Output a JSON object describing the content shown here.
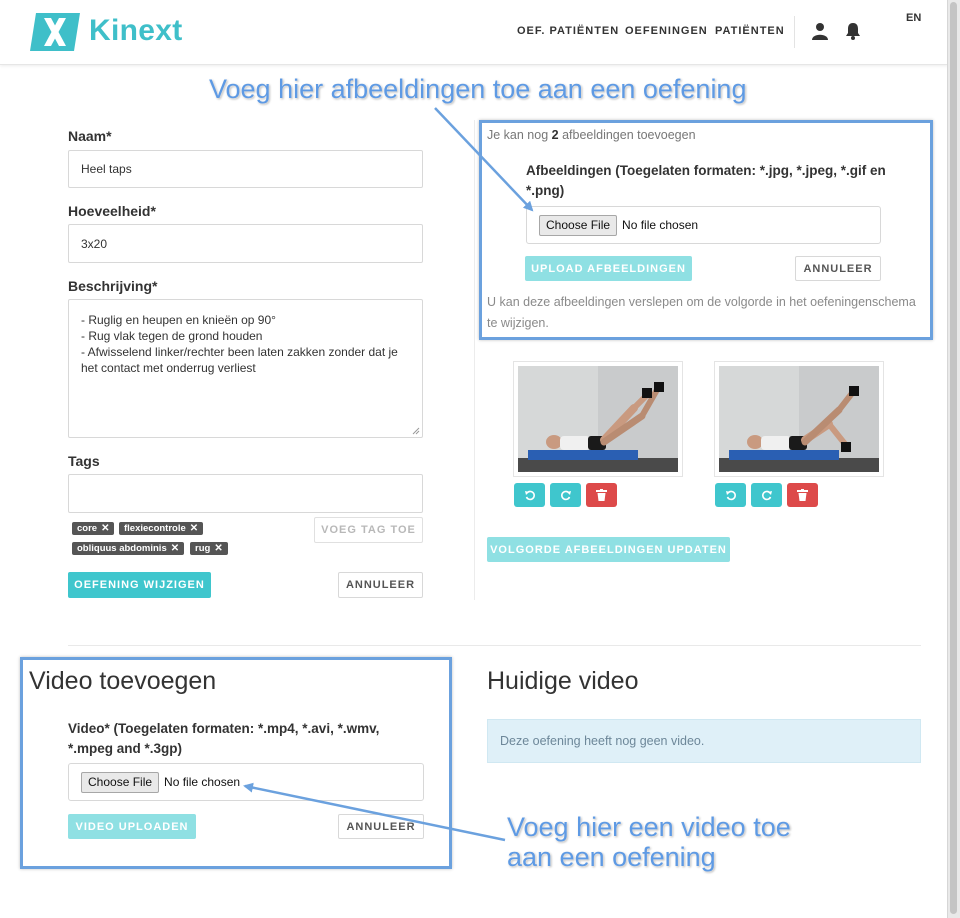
{
  "header": {
    "brand": "Kinext",
    "nav": [
      "OEF. PATIËNTEN",
      "OEFENINGEN",
      "PATIËNTEN"
    ],
    "lang": "EN"
  },
  "form": {
    "name_label": "Naam*",
    "name_value": "Heel taps",
    "quantity_label": "Hoeveelheid*",
    "quantity_value": "3x20",
    "description_label": "Beschrijving*",
    "description_lines": [
      "- Ruglig en heupen en knieën op 90°",
      "- Rug vlak tegen de grond houden",
      "- Afwisselend linker/rechter been laten zakken zonder dat je",
      "het contact met onderrug verliest"
    ],
    "tags_label": "Tags",
    "tags": [
      "core",
      "flexiecontrole",
      "obliquus abdominis",
      "rug"
    ],
    "tag_remove": "✕",
    "add_tag_button": "VOEG TAG TOE",
    "submit_button": "OEFENING WIJZIGEN",
    "cancel_button": "ANNULEER"
  },
  "images": {
    "remaining_prefix": "Je kan nog ",
    "remaining_count": "2",
    "remaining_suffix": " afbeeldingen toevoegen",
    "field_label_1": "Afbeeldingen (Toegelaten formaten: *.jpg, *.jpeg, *.gif en",
    "field_label_2": "*.png)",
    "choose_file": "Choose File",
    "no_file": "No file chosen",
    "upload_button": "UPLOAD AFBEELDINGEN",
    "cancel_button": "ANNULEER",
    "hint_line_1": "U kan deze afbeeldingen verslepen om de volgorde in het oefeningenschema",
    "hint_line_2": "te wijzigen.",
    "update_order_button": "VOLGORDE AFBEELDINGEN UPDATEN"
  },
  "video": {
    "title": "Video toevoegen",
    "field_label_1": "Video* (Toegelaten formaten: *.mp4, *.avi, *.wmv,",
    "field_label_2": "*.mpeg and *.3gp)",
    "choose_file": "Choose File",
    "no_file": "No file chosen",
    "upload_button": "VIDEO UPLOADEN",
    "cancel_button": "ANNULEER"
  },
  "current_video": {
    "title": "Huidige video",
    "message": "Deze oefening heeft nog geen video."
  },
  "annotations": {
    "images_note": "Voeg hier afbeeldingen toe aan een oefening",
    "video_note_line_1": "Voeg hier een video toe",
    "video_note_line_2": "aan een oefening"
  },
  "colors": {
    "accent": "#3fc6cd",
    "danger": "#dd4a4a",
    "annotation": "#6ba1de"
  }
}
